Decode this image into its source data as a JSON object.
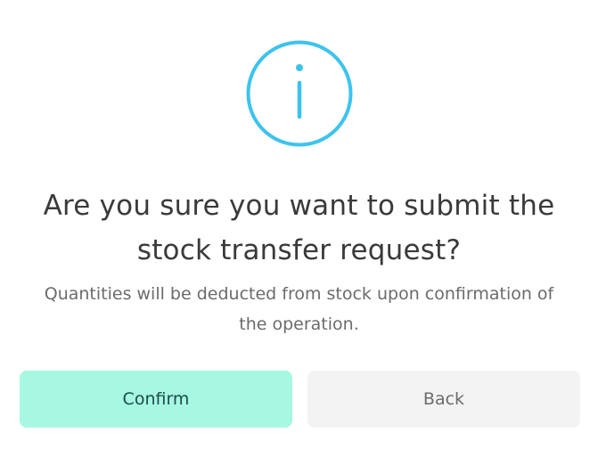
{
  "dialog": {
    "icon": "info-icon",
    "accent_color": "#3cc3ee",
    "title": "Are you sure you want to submit the stock transfer request?",
    "message": "Quantities will be deducted from stock upon confirmation of the operation.",
    "buttons": {
      "confirm_label": "Confirm",
      "confirm_color": "#a6f8e2",
      "back_label": "Back",
      "back_color": "#f3f3f3"
    }
  }
}
